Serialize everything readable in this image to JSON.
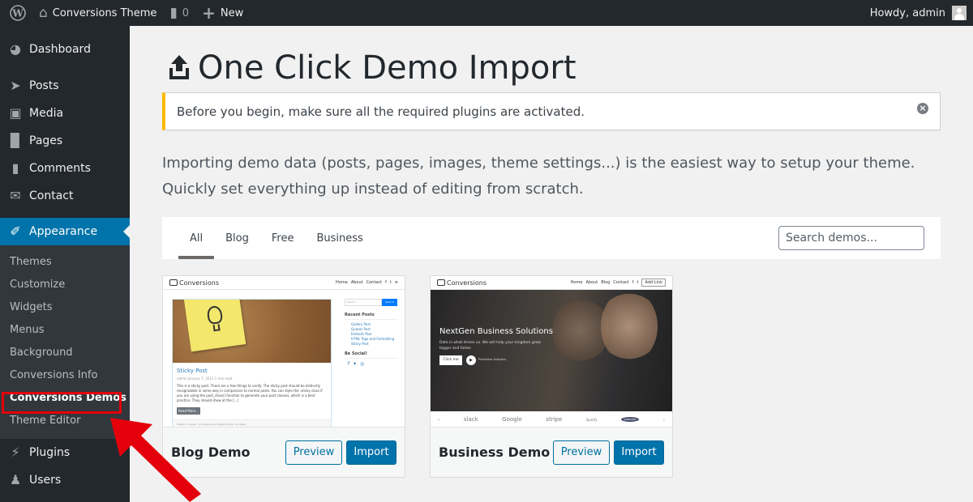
{
  "adminbar": {
    "site_name": "Conversions Theme",
    "comments_count": "0",
    "new_label": "New",
    "greeting": "Howdy, admin"
  },
  "sidebar": {
    "items": [
      {
        "label": "Dashboard",
        "icon": "dashboard-icon"
      },
      {
        "label": "Posts",
        "icon": "pin-icon"
      },
      {
        "label": "Media",
        "icon": "media-icon"
      },
      {
        "label": "Pages",
        "icon": "pages-icon"
      },
      {
        "label": "Comments",
        "icon": "comment-icon"
      },
      {
        "label": "Contact",
        "icon": "envelope-icon"
      },
      {
        "label": "Appearance",
        "icon": "paintbrush-icon",
        "current": true
      }
    ],
    "submenu": [
      {
        "label": "Themes"
      },
      {
        "label": "Customize"
      },
      {
        "label": "Widgets"
      },
      {
        "label": "Menus"
      },
      {
        "label": "Background"
      },
      {
        "label": "Conversions Info"
      },
      {
        "label": "Conversions Demos",
        "active": true
      },
      {
        "label": "Theme Editor"
      }
    ],
    "items_after": [
      {
        "label": "Plugins",
        "icon": "plug-icon"
      },
      {
        "label": "Users",
        "icon": "user-icon"
      }
    ]
  },
  "main": {
    "title": "One Click Demo Import",
    "notice": "Before you begin, make sure all the required plugins are activated.",
    "intro": "Importing demo data (posts, pages, images, theme settings...) is the easiest way to setup your theme. Quickly set everything up instead of editing from scratch.",
    "tabs": [
      {
        "label": "All",
        "active": true
      },
      {
        "label": "Blog"
      },
      {
        "label": "Free"
      },
      {
        "label": "Business"
      }
    ],
    "search_placeholder": "Search demos...",
    "demos": [
      {
        "name": "Blog Demo",
        "preview_label": "Preview",
        "import_label": "Import",
        "site": {
          "logo": "Conversions",
          "nav": [
            "Home",
            "About",
            "Contact",
            "f",
            "t",
            "≡"
          ],
          "post_title": "Sticky Post",
          "post_meta": "admin  January 7, 2012  1 min read",
          "post_text": "This is a sticky post. There are a few things to verify: The sticky post should be distinctly recognizable in some way in comparison to normal posts. You can style the .sticky class if you are using the post_class() function to generate your post classes, which is a best practice. They should show at the [...]",
          "read_more": "Read More...",
          "post_footer": "Posted in Classic, Uncategorized   Tagged sticky, template",
          "search_placeholder": "Search ...",
          "search_button": "Search",
          "recent_posts_heading": "Recent Posts",
          "recent_posts": [
            "Gallery Post",
            "Quotes Post",
            "Embeds Post",
            "HTML Tags and Formatting",
            "Sticky Post"
          ],
          "social_heading": "Be Social!"
        }
      },
      {
        "name": "Business Demo",
        "preview_label": "Preview",
        "import_label": "Import",
        "site": {
          "logo": "Conversions",
          "nav": [
            "Home",
            "About",
            "Blog",
            "Contact",
            "f",
            "t"
          ],
          "nav_button": "Add Link",
          "hero_title": "NextGen Business Solutions",
          "hero_text": "Data is what drives us. We will help your kingdom grow bigger and faster.",
          "cta": "Click me",
          "play_label": "Predictive Analytics",
          "logos": [
            "slack",
            "Google",
            "stripe",
            "Spotify",
            "SAMSUNG"
          ]
        }
      }
    ]
  },
  "colors": {
    "accent": "#0073aa",
    "notice_border": "#ffb900",
    "annotation": "#e3000b"
  }
}
